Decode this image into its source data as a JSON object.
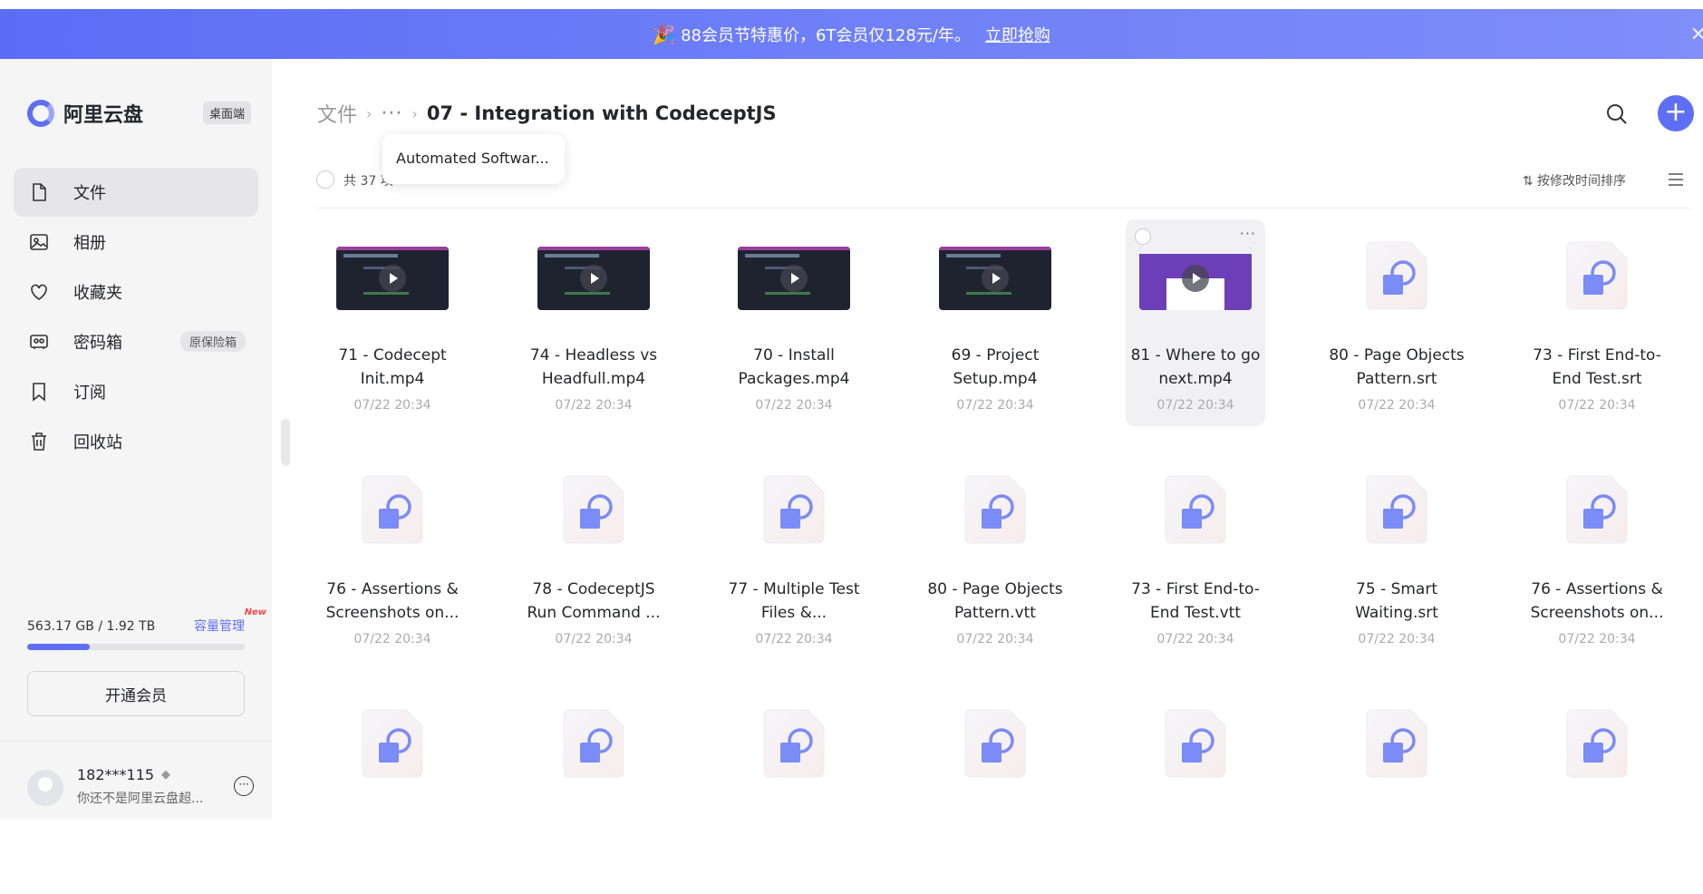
{
  "banner": {
    "text": "88会员节特惠价，6T会员仅128元/年。",
    "cta": "立即抢购",
    "party_icon": "🎉"
  },
  "sidebar": {
    "app_name": "阿里云盘",
    "desktop_badge": "桌面端",
    "items": [
      {
        "label": "文件",
        "icon": "file-icon",
        "active": true
      },
      {
        "label": "相册",
        "icon": "photo-album-icon"
      },
      {
        "label": "收藏夹",
        "icon": "heart-icon"
      },
      {
        "label": "密码箱",
        "icon": "safe-icon",
        "tag": "原保险箱"
      },
      {
        "label": "订阅",
        "icon": "bookmark-icon"
      },
      {
        "label": "回收站",
        "icon": "trash-icon"
      }
    ],
    "storage": {
      "text": "563.17 GB / 1.92 TB",
      "manage": "容量管理",
      "new_tag": "New",
      "used_fraction": 0.287
    },
    "vip_button": "开通会员",
    "user": {
      "name": "182***115",
      "subtitle": "你还不是阿里云盘超..."
    }
  },
  "header": {
    "breadcrumb_root": "文件",
    "breadcrumb_ellipsis": "···",
    "breadcrumb_current": "07 - Integration with CodeceptJS",
    "tooltip": "Automated Softwar..."
  },
  "toolbar": {
    "count": "共 37 项",
    "sort": "按修改时间排序"
  },
  "accent": "#5e6ff5",
  "files": [
    {
      "name_line1": "71 - Codecept",
      "name_line2": "Init.mp4",
      "date": "07/22 20:34",
      "type": "video"
    },
    {
      "name_line1": "74 - Headless vs",
      "name_line2": "Headfull.mp4",
      "date": "07/22 20:34",
      "type": "video"
    },
    {
      "name_line1": "70 - Install",
      "name_line2": "Packages.mp4",
      "date": "07/22 20:34",
      "type": "video"
    },
    {
      "name_line1": "69 - Project",
      "name_line2": "Setup.mp4",
      "date": "07/22 20:34",
      "type": "video"
    },
    {
      "name_line1": "81 - Where to go",
      "name_line2": "next.mp4",
      "date": "07/22 20:34",
      "type": "video-purple"
    },
    {
      "name_line1": "80 - Page Objects",
      "name_line2": "Pattern.srt",
      "date": "07/22 20:34",
      "type": "doc"
    },
    {
      "name_line1": "73 - First End-to-",
      "name_line2": "End Test.srt",
      "date": "07/22 20:34",
      "type": "doc"
    },
    {
      "name_line1": "76 - Assertions &",
      "name_line2": "Screenshots on...",
      "date": "07/22 20:34",
      "type": "doc"
    },
    {
      "name_line1": "78 - CodeceptJS",
      "name_line2": "Run Command ...",
      "date": "07/22 20:34",
      "type": "doc"
    },
    {
      "name_line1": "77 - Multiple Test",
      "name_line2": "Files &...",
      "date": "07/22 20:34",
      "type": "doc"
    },
    {
      "name_line1": "80 - Page Objects",
      "name_line2": "Pattern.vtt",
      "date": "07/22 20:34",
      "type": "doc"
    },
    {
      "name_line1": "73 - First End-to-",
      "name_line2": "End Test.vtt",
      "date": "07/22 20:34",
      "type": "doc"
    },
    {
      "name_line1": "75 - Smart",
      "name_line2": "Waiting.srt",
      "date": "07/22 20:34",
      "type": "doc"
    },
    {
      "name_line1": "76 - Assertions &",
      "name_line2": "Screenshots on...",
      "date": "07/22 20:34",
      "type": "doc"
    },
    {
      "type": "doc"
    },
    {
      "type": "doc"
    },
    {
      "type": "doc"
    },
    {
      "type": "doc"
    },
    {
      "type": "doc"
    },
    {
      "type": "doc"
    },
    {
      "type": "doc"
    }
  ]
}
